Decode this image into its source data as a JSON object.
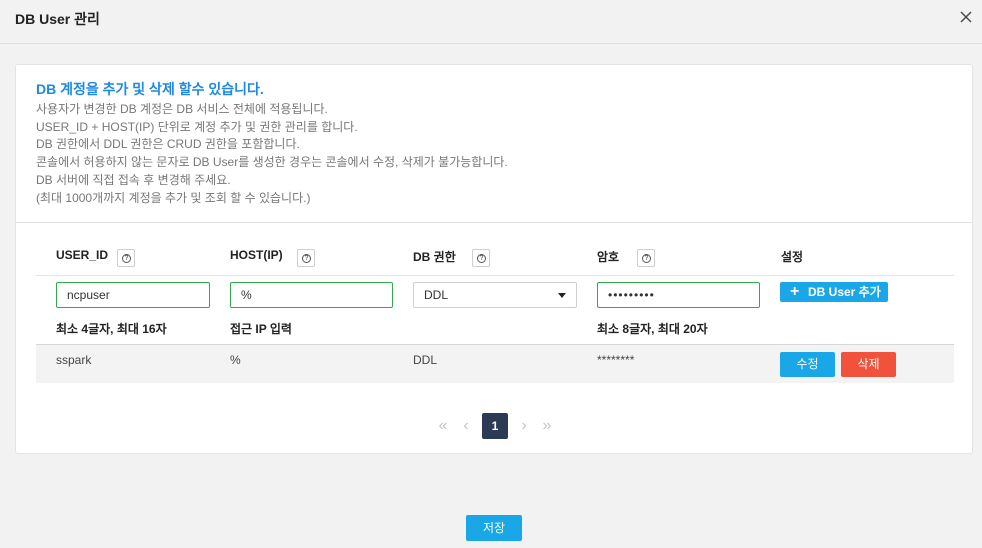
{
  "modal": {
    "title": "DB User 관리"
  },
  "notice": {
    "title": "DB 계정을 추가 및 삭제 할수 있습니다.",
    "lines": [
      "사용자가 변경한 DB 계정은 DB 서비스 전체에 적용됩니다.",
      "USER_ID + HOST(IP) 단위로 계정 추가 및 권한 관리를 합니다.",
      "DB 권한에서 DDL 권한은 CRUD 권한을 포함합니다.",
      "콘솔에서 허용하지 않는 문자로 DB User를 생성한 경우는 콘솔에서 수정, 삭제가 불가능합니다.",
      "DB 서버에 직접 접속 후 변경해 주세요.",
      "(최대 1000개까지 계정을 추가 및 조회 할 수 있습니다.)"
    ]
  },
  "table": {
    "headers": {
      "user_id": "USER_ID",
      "host": "HOST(IP)",
      "privilege": "DB 권한",
      "password": "암호",
      "settings": "설정"
    },
    "help_glyph": "?",
    "form": {
      "user_id_value": "ncpuser",
      "host_value": "%",
      "privilege_value": "DDL",
      "password_value": "•••••••••",
      "add_button": "DB User 추가",
      "add_icon": "+",
      "user_id_hint": "최소 4글자, 최대 16자",
      "host_hint": "접근 IP 입력",
      "password_hint": "최소 8글자, 최대 20자"
    },
    "rows": [
      {
        "user_id": "sspark",
        "host": "%",
        "privilege": "DDL",
        "password": "********",
        "edit_label": "수정",
        "delete_label": "삭제"
      }
    ]
  },
  "pagination": {
    "first": "«",
    "prev": "‹",
    "current": "1",
    "next": "›",
    "last": "»"
  },
  "footer": {
    "save_label": "저장"
  },
  "icons": {
    "close": "close-icon",
    "help": "help-icon",
    "dropdown": "chevron-down-icon",
    "add": "plus-icon"
  },
  "colors": {
    "accent": "#19a7e8",
    "danger": "#f0523c",
    "valid_border": "#2eac4a",
    "title_blue": "#1e88e5",
    "page_active": "#2b3a55"
  }
}
